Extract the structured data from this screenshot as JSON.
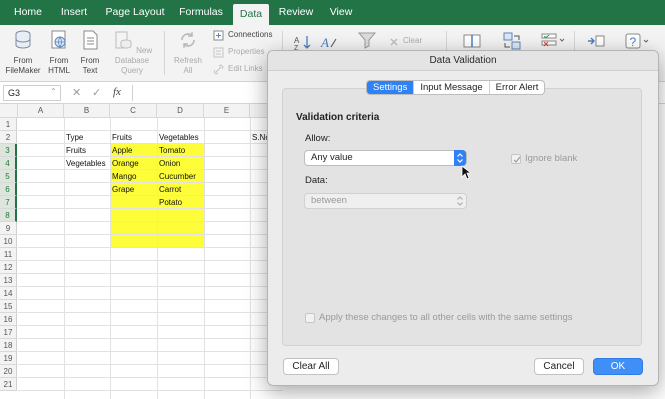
{
  "ribbon_tabs": [
    {
      "label": "Home"
    },
    {
      "label": "Insert"
    },
    {
      "label": "Page Layout"
    },
    {
      "label": "Formulas"
    },
    {
      "label": "Data",
      "active": true
    },
    {
      "label": "Review"
    },
    {
      "label": "View"
    }
  ],
  "ribbon": {
    "from_filemaker": "From FileMaker",
    "from_html": "From HTML",
    "from_text": "From Text",
    "new_database_query": "New Database Query",
    "refresh_all": "Refresh All",
    "connections": "Connections",
    "properties": "Properties",
    "edit_links": "Edit Links",
    "clear": "Clear"
  },
  "formula_bar": {
    "name_box": "G3",
    "cancel_glyph": "✕",
    "enter_glyph": "✓",
    "fx_glyph": "fx"
  },
  "sheet": {
    "columns": [
      "A",
      "B",
      "C",
      "D",
      "E"
    ],
    "rows": [
      "1",
      "2",
      "3",
      "4",
      "5",
      "6",
      "7",
      "8",
      "9",
      "10",
      "11",
      "12",
      "13",
      "14",
      "15",
      "16",
      "17",
      "18",
      "19",
      "20",
      "21"
    ],
    "active_row": "3",
    "cells": {
      "b2": "Type",
      "c2": "Fruits",
      "d2": "Vegetables",
      "b3": "Fruits",
      "c3": "Apple",
      "d3": "Tomato",
      "b4": "Vegetables",
      "c4": "Orange",
      "d4": "Onion",
      "c5": "Mango",
      "d5": "Cucumber",
      "c6": "Grape",
      "d6": "Carrot",
      "d7": "Potato",
      "f2": "S.No"
    },
    "highlight_color": "#fdfd3a"
  },
  "dialog": {
    "title": "Data Validation",
    "tabs": [
      {
        "label": "Settings",
        "active": true
      },
      {
        "label": "Input Message"
      },
      {
        "label": "Error Alert"
      }
    ],
    "criteria_heading": "Validation criteria",
    "allow_label": "Allow:",
    "allow_value": "Any value",
    "ignore_blank_label": "Ignore blank",
    "ignore_blank_checked": true,
    "data_label": "Data:",
    "data_value": "between",
    "apply_all_label": "Apply these changes to all other cells with the same settings",
    "apply_all_checked": false,
    "clear_all": "Clear All",
    "cancel": "Cancel",
    "ok": "OK",
    "accent": "#2f82f5"
  }
}
